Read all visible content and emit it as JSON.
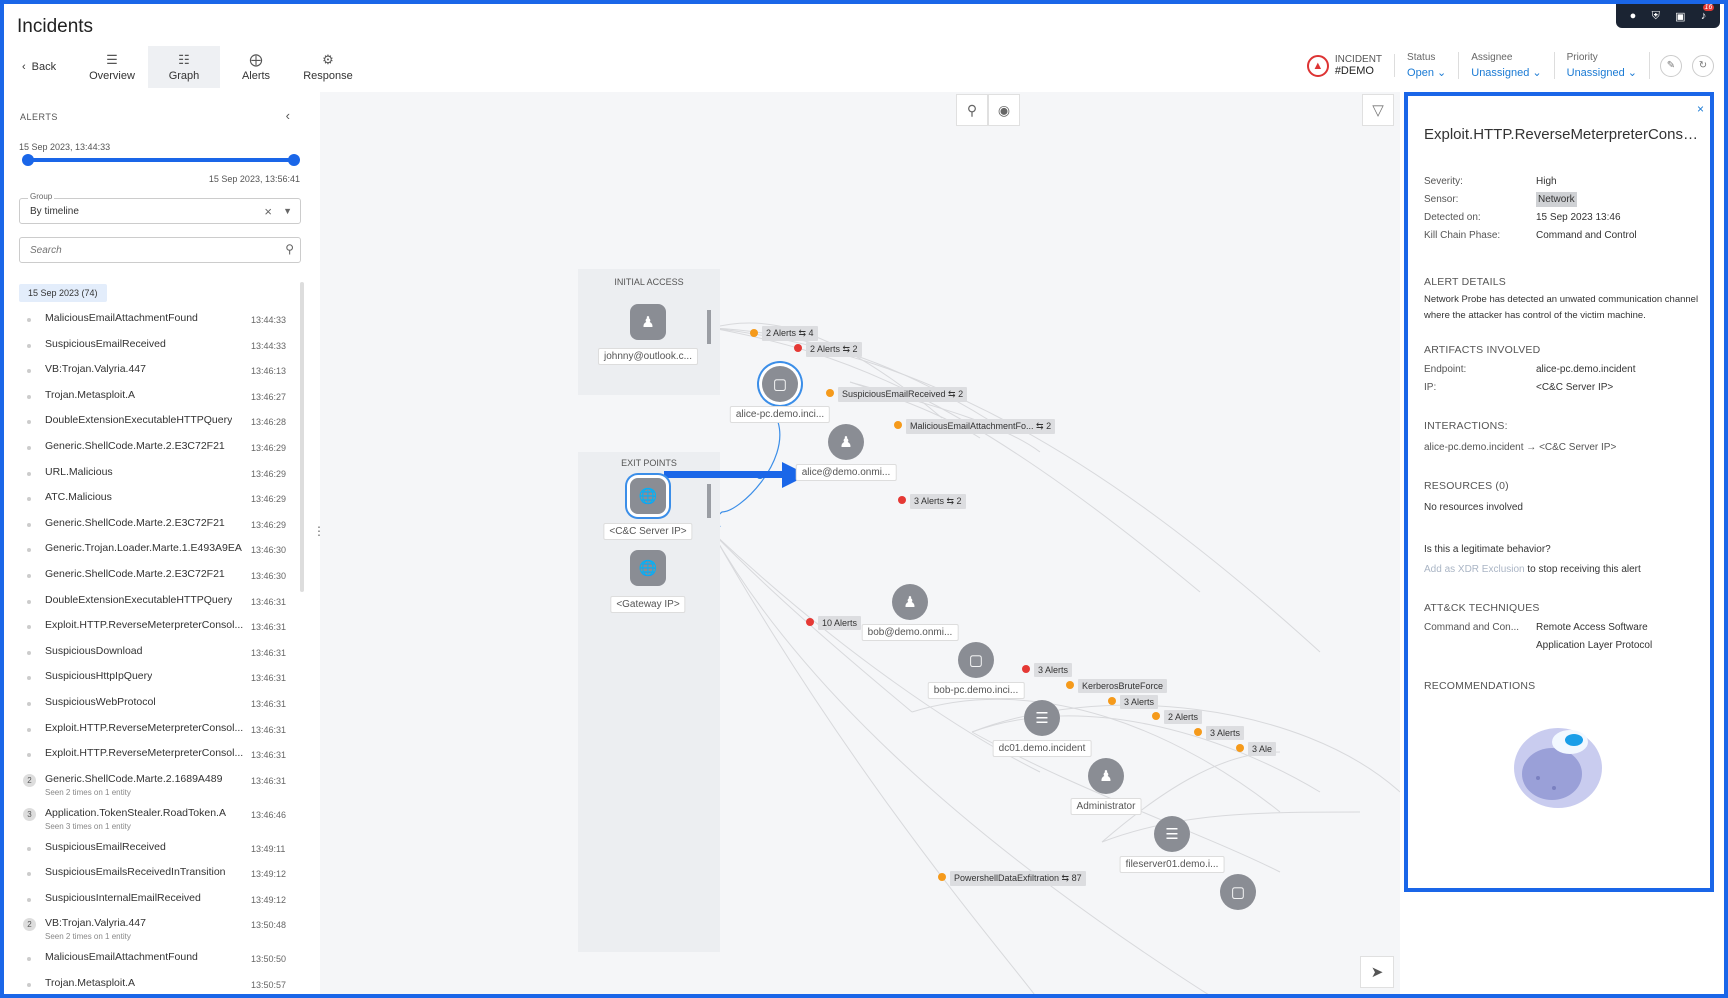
{
  "app": {
    "title": "Incidents"
  },
  "toolbar": {
    "back": "Back",
    "tabs": [
      {
        "label": "Overview",
        "icon": "list-icon"
      },
      {
        "label": "Graph",
        "icon": "graph-icon"
      },
      {
        "label": "Alerts",
        "icon": "alerts-icon"
      },
      {
        "label": "Response",
        "icon": "response-icon"
      }
    ]
  },
  "top_icons": {
    "notif_count": "16"
  },
  "header": {
    "incident_label": "INCIDENT",
    "incident_id": "#DEMO",
    "status_key": "Status",
    "status_val": "Open",
    "assignee_key": "Assignee",
    "assignee_val": "Unassigned",
    "priority_key": "Priority",
    "priority_val": "Unassigned"
  },
  "sidebar": {
    "title": "ALERTS",
    "start": "15 Sep 2023, 13:44:33",
    "end": "15 Sep 2023, 13:56:41",
    "group_label": "Group",
    "group_value": "By timeline",
    "search_placeholder": "Search",
    "date_chip": "15 Sep 2023  (74)",
    "items": [
      {
        "name": "MaliciousEmailAttachmentFound",
        "time": "13:44:33"
      },
      {
        "name": "SuspiciousEmailReceived",
        "time": "13:44:33"
      },
      {
        "name": "VB:Trojan.Valyria.447",
        "time": "13:46:13"
      },
      {
        "name": "Trojan.Metasploit.A",
        "time": "13:46:27"
      },
      {
        "name": "DoubleExtensionExecutableHTTPQuery",
        "time": "13:46:28"
      },
      {
        "name": "Generic.ShellCode.Marte.2.E3C72F21",
        "time": "13:46:29"
      },
      {
        "name": "URL.Malicious",
        "time": "13:46:29"
      },
      {
        "name": "ATC.Malicious",
        "time": "13:46:29"
      },
      {
        "name": "Generic.ShellCode.Marte.2.E3C72F21",
        "time": "13:46:29"
      },
      {
        "name": "Generic.Trojan.Loader.Marte.1.E493A9EA",
        "time": "13:46:30"
      },
      {
        "name": "Generic.ShellCode.Marte.2.E3C72F21",
        "time": "13:46:30"
      },
      {
        "name": "DoubleExtensionExecutableHTTPQuery",
        "time": "13:46:31"
      },
      {
        "name": "Exploit.HTTP.ReverseMeterpreterConsol...",
        "time": "13:46:31"
      },
      {
        "name": "SuspiciousDownload",
        "time": "13:46:31"
      },
      {
        "name": "SuspiciousHttpIpQuery",
        "time": "13:46:31"
      },
      {
        "name": "SuspiciousWebProtocol",
        "time": "13:46:31"
      },
      {
        "name": "Exploit.HTTP.ReverseMeterpreterConsol...",
        "time": "13:46:31"
      },
      {
        "name": "Exploit.HTTP.ReverseMeterpreterConsol...",
        "time": "13:46:31"
      },
      {
        "name": "Generic.ShellCode.Marte.2.1689A489",
        "time": "13:46:31",
        "count": "2",
        "sub": "Seen 2 times on 1 entity"
      },
      {
        "name": "Application.TokenStealer.RoadToken.A",
        "time": "13:46:46",
        "count": "3",
        "sub": "Seen 3 times on 1 entity"
      },
      {
        "name": "SuspiciousEmailReceived",
        "time": "13:49:11"
      },
      {
        "name": "SuspiciousEmailsReceivedInTransition",
        "time": "13:49:12"
      },
      {
        "name": "SuspiciousInternalEmailReceived",
        "time": "13:49:12"
      },
      {
        "name": "VB:Trojan.Valyria.447",
        "time": "13:50:48",
        "count": "2",
        "sub": "Seen 2 times on 1 entity"
      },
      {
        "name": "MaliciousEmailAttachmentFound",
        "time": "13:50:50"
      },
      {
        "name": "Trojan.Metasploit.A",
        "time": "13:50:57"
      }
    ]
  },
  "graph": {
    "col1_title": "INITIAL ACCESS",
    "col2_title": "EXIT POINTS",
    "nodes": {
      "johnny": "johnny@outlook.c...",
      "cc": "<C&C Server IP>",
      "gateway": "<Gateway IP>",
      "alice_pc": "alice-pc.demo.inci...",
      "alice": "alice@demo.onmi...",
      "bob": "bob@demo.onmi...",
      "bob_pc": "bob-pc.demo.inci...",
      "dc01": "dc01.demo.incident",
      "admin": "Administrator",
      "fileserver": "fileserver01.demo.i..."
    },
    "alert_labels": {
      "a1": "2 Alerts ⇆ 4",
      "a2": "2 Alerts ⇆ 2",
      "a3": "SuspiciousEmailReceived ⇆ 2",
      "a4": "MaliciousEmailAttachmentFo... ⇆ 2",
      "a5": "3 Alerts ⇆ 2",
      "a6": "10 Alerts",
      "a7": "3 Alerts",
      "a8": "KerberosBruteForce",
      "a9": "3 Alerts",
      "a10": "2 Alerts",
      "a11": "3 Alerts",
      "a12": "3 Ale",
      "a13": "PowershellDataExfiltration ⇆ 87"
    }
  },
  "panel": {
    "title": "Exploit.HTTP.ReverseMeterpreterConsol...",
    "severity_k": "Severity:",
    "severity_v": "High",
    "sensor_k": "Sensor:",
    "sensor_v": "Network",
    "detected_k": "Detected on:",
    "detected_v": "15 Sep 2023 13:46",
    "kill_k": "Kill Chain Phase:",
    "kill_v": "Command and Control",
    "alert_details_t": "ALERT DETAILS",
    "alert_details": "Network Probe has detected an unwated communication channel where the attacker has control of the victim machine.",
    "artifacts_t": "ARTIFACTS INVOLVED",
    "endpoint_k": "Endpoint:",
    "endpoint_v": "alice-pc.demo.incident",
    "ip_k": "IP:",
    "ip_v": "<C&C Server IP>",
    "interactions_t": "INTERACTIONS:",
    "inter_from": "alice-pc.demo.incident",
    "inter_to": "<C&C Server IP>",
    "resources_t": "RESOURCES (0)",
    "resources": "No resources involved",
    "legit_q": "Is this a legitimate behavior?",
    "add_excl": "Add as XDR Exclusion",
    "stop_recv": "to stop receiving this alert",
    "attck_t": "ATT&CK TECHNIQUES",
    "attck_k": "Command and Con...",
    "attck_v1": "Remote Access Software",
    "attck_v2": "Application Layer Protocol",
    "recs_t": "RECOMMENDATIONS"
  },
  "colors": {
    "accent": "#1a66e8",
    "link": "#1a7ad4",
    "danger": "#d33",
    "orange": "#f59a1b"
  }
}
